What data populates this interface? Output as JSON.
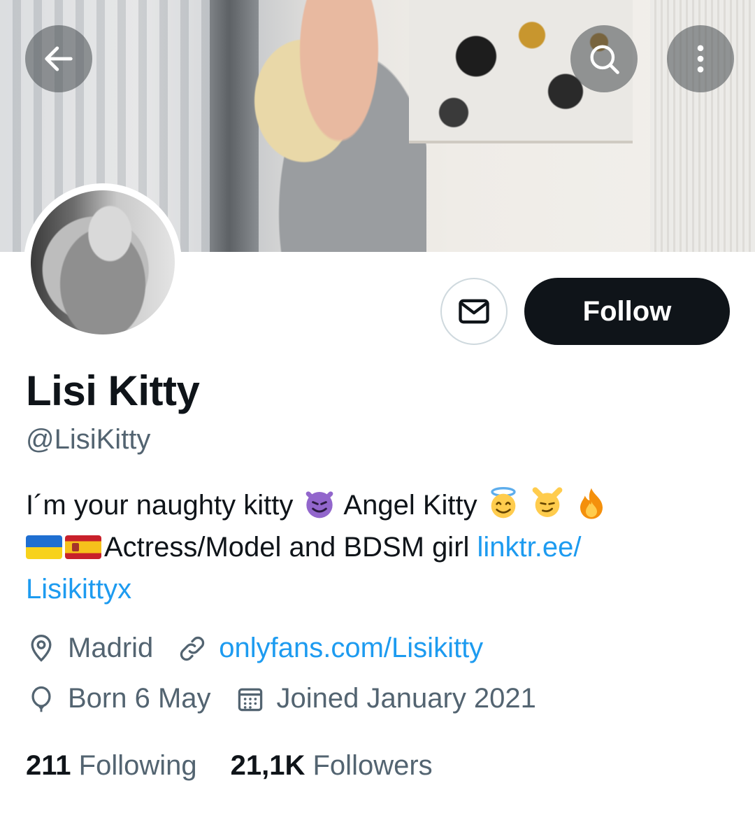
{
  "header": {
    "back_icon": "arrow-left-icon",
    "search_icon": "search-icon",
    "more_icon": "more-vertical-icon"
  },
  "profile": {
    "name": "Lisi Kitty",
    "handle": "@LisiKitty",
    "follow_label": "Follow",
    "message_icon": "envelope-icon",
    "bio": {
      "line1_text_a": "I´m your naughty kitty",
      "line1_text_b": "Angel Kitty",
      "emojis": [
        "smiling-imp-icon",
        "halo-face-icon",
        "smirk-cat-icon",
        "fire-icon"
      ],
      "flags": [
        "ukraine-flag-icon",
        "spain-flag-icon"
      ],
      "line2_text": "Actress/Model and BDSM girl",
      "link_part1": "linktr.ee/",
      "link_part2": "Lisikittyx"
    },
    "location": "Madrid",
    "website": "onlyfans.com/Lisikitty",
    "birthday": "Born 6 May",
    "joined": "Joined January 2021",
    "following_count": "211",
    "following_label": "Following",
    "followers_count": "21,1K",
    "followers_label": "Followers"
  },
  "colors": {
    "text": "#0f1419",
    "muted": "#536471",
    "link": "#1d9bf0",
    "button": "#0f1419"
  }
}
